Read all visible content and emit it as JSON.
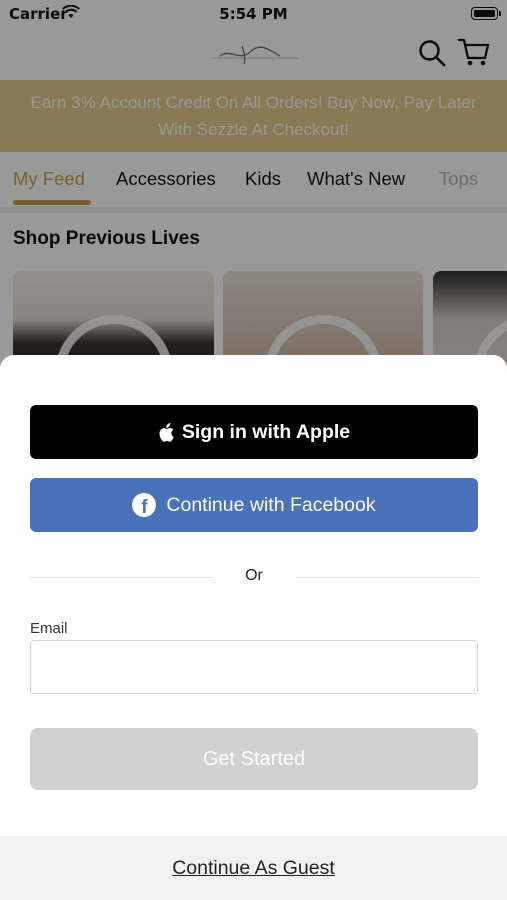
{
  "status_bar": {
    "carrier": "Carrier",
    "time": "5:54 PM"
  },
  "header": {
    "logo_icon": "brand-script-logo",
    "search_icon": "search-icon",
    "cart_icon": "cart-icon"
  },
  "banner": {
    "text": "Earn 3% Account Credit On All Orders! Buy Now, Pay Later With Sezzle At Checkout!",
    "color": "#e3c98b"
  },
  "tabs": [
    {
      "label": "My Feed",
      "active": true
    },
    {
      "label": "Accessories"
    },
    {
      "label": "Kids"
    },
    {
      "label": "What's New"
    },
    {
      "label": "Tops"
    }
  ],
  "feed": {
    "section_title": "Shop Previous Lives"
  },
  "login_sheet": {
    "apple_button": "Sign in with Apple",
    "facebook_button": "Continue with Facebook",
    "divider_text": "Or",
    "email_label": "Email",
    "email_value": "",
    "email_placeholder": "",
    "submit_button": "Get Started",
    "guest_link": "Continue As Guest"
  },
  "colors": {
    "accent": "#c9a14a",
    "facebook": "#4a72b8",
    "disabled": "#d1d1d1"
  }
}
